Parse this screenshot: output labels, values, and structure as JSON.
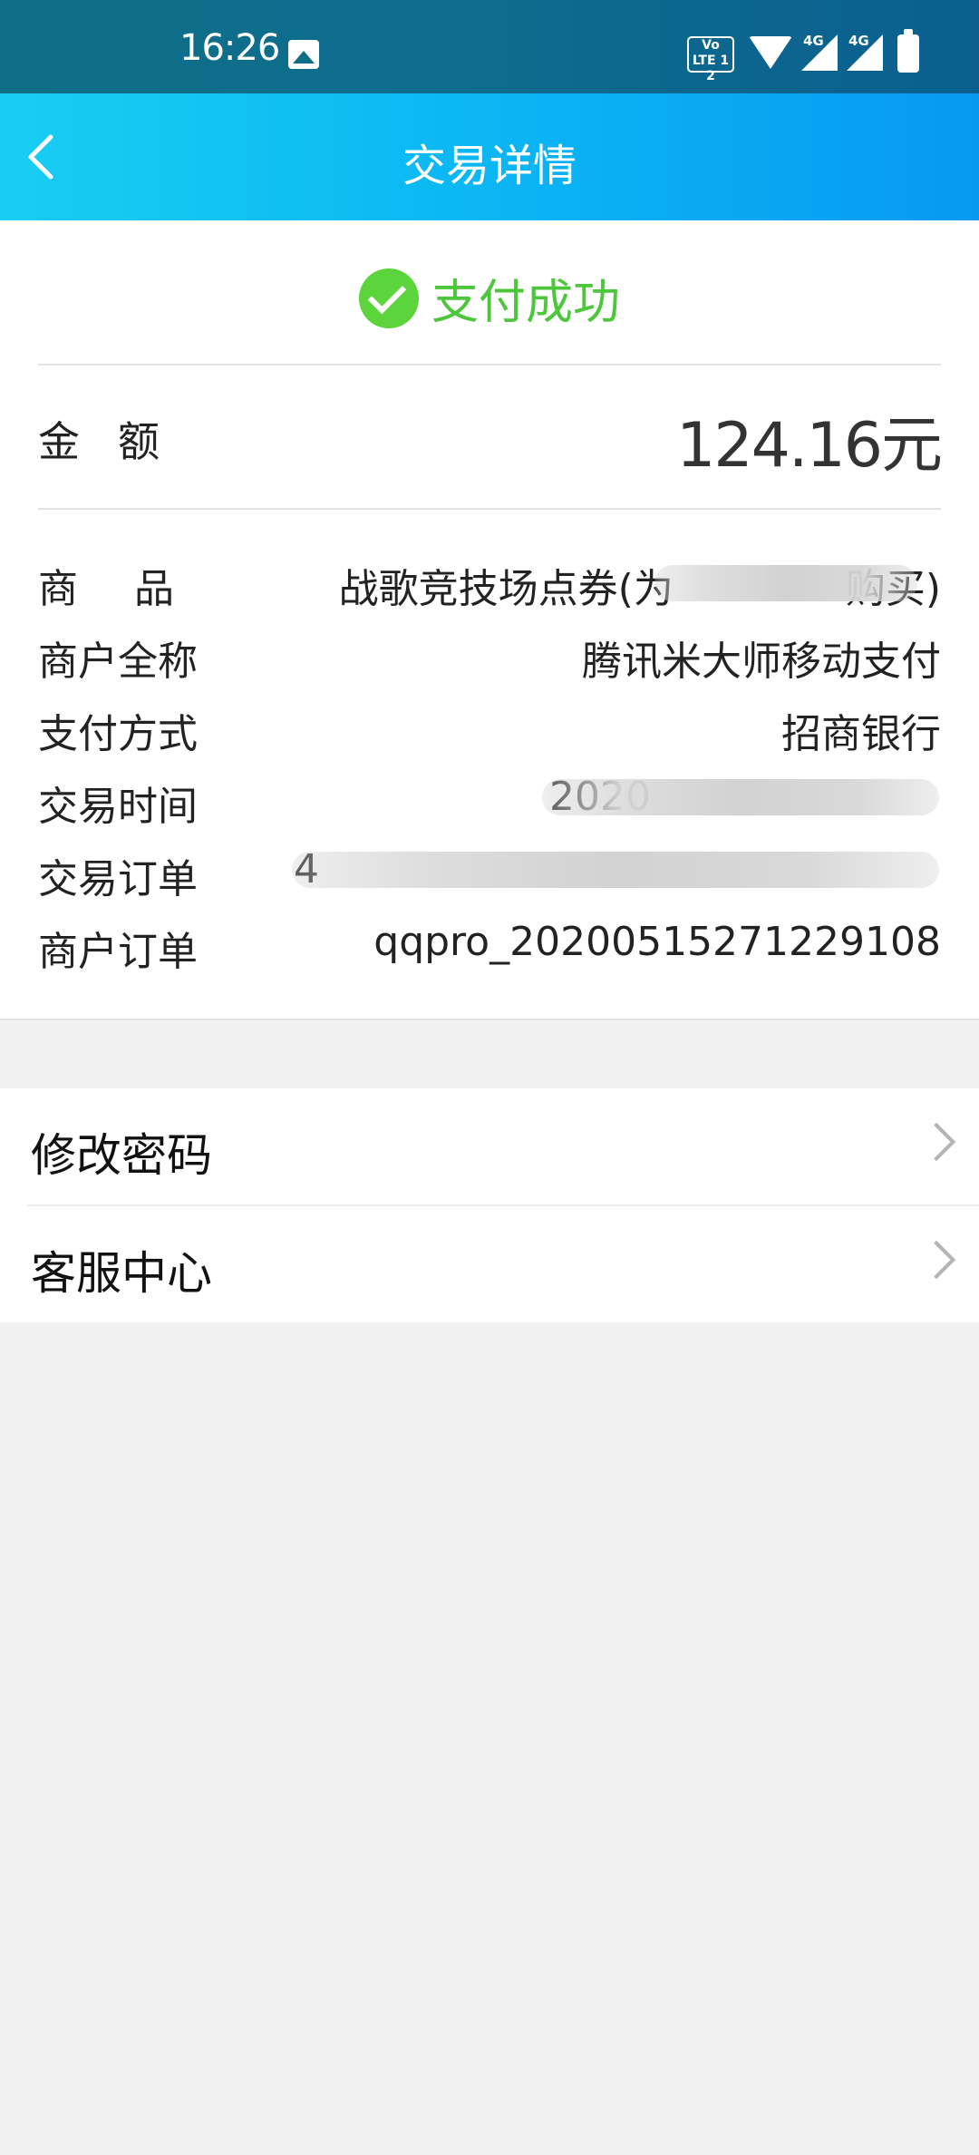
{
  "status_bar": {
    "time": "16:26",
    "icons": [
      "image-icon",
      "volte-icon",
      "wifi-icon",
      "signal-4g-icon",
      "signal-4g-icon",
      "battery-icon"
    ],
    "volte_text": "Vo LTE 1 2",
    "net1": "4G",
    "net2": "4G"
  },
  "header": {
    "title": "交易详情",
    "back_icon": "chevron-left-icon"
  },
  "status": {
    "icon": "check-circle-icon",
    "text": "支付成功",
    "color": "#4cc63b"
  },
  "amount": {
    "label": "金额",
    "value": "124.16元"
  },
  "details": [
    {
      "label": "商品",
      "value": "战歌竞技场点券(为",
      "value_suffix": "购买)"
    },
    {
      "label": "商户全称",
      "value": "腾讯米大师移动支付"
    },
    {
      "label": "支付方式",
      "value": "招商银行"
    },
    {
      "label": "交易时间",
      "value": "2020"
    },
    {
      "label": "交易订单",
      "value": "4"
    },
    {
      "label": "商户订单",
      "value": "qqpro_20200515271229108"
    }
  ],
  "menu": [
    {
      "label": "修改密码",
      "icon": "chevron-right-icon"
    },
    {
      "label": "客服中心",
      "icon": "chevron-right-icon"
    }
  ],
  "colors": {
    "status_bar": "#0e6c8e",
    "title_bar_start": "#19cdf2",
    "title_bar_end": "#0799f2",
    "success": "#5cd43c",
    "background": "#f1f1f1"
  }
}
